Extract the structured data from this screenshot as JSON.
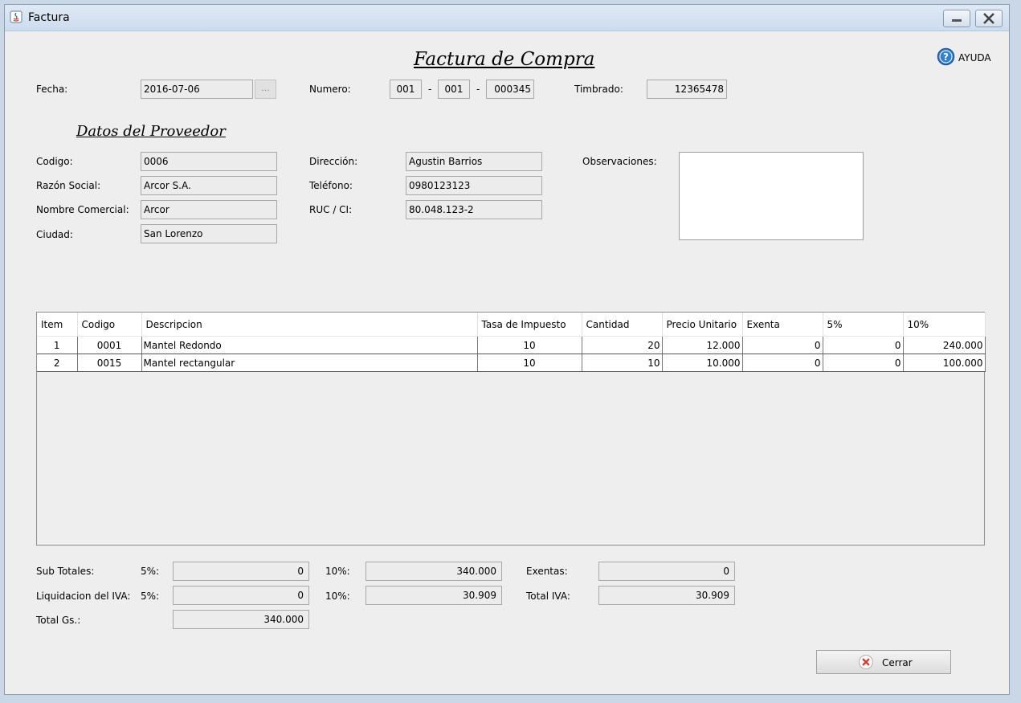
{
  "window": {
    "title": "Factura"
  },
  "header": {
    "title": "Factura de Compra",
    "help_label": "AYUDA"
  },
  "invoice": {
    "fecha_label": "Fecha:",
    "fecha_value": "2016-07-06",
    "date_button_label": "...",
    "numero_label": "Numero:",
    "numero_1": "001",
    "numero_sep_1": "-",
    "numero_2": "001",
    "numero_sep_2": "-",
    "numero_3": "000345",
    "timbrado_label": "Timbrado:",
    "timbrado_value": "12365478"
  },
  "proveedor": {
    "section_title": "Datos del Proveedor",
    "codigo_label": "Codigo:",
    "codigo_value": "0006",
    "razon_label": "Razón Social:",
    "razon_value": "Arcor S.A.",
    "nombre_label": "Nombre Comercial:",
    "nombre_value": "Arcor",
    "ciudad_label": "Ciudad:",
    "ciudad_value": "San Lorenzo",
    "direccion_label": "Dirección:",
    "direccion_value": "Agustin Barrios",
    "telefono_label": "Teléfono:",
    "telefono_value": "0980123123",
    "ruc_label": "RUC / CI:",
    "ruc_value": "80.048.123-2",
    "observaciones_label": "Observaciones:",
    "observaciones_value": ""
  },
  "table": {
    "columns": [
      "Item",
      "Codigo",
      "Descripcion",
      "Tasa de Impuesto",
      "Cantidad",
      "Precio Unitario",
      "Exenta",
      "5%",
      "10%"
    ],
    "rows": [
      [
        "1",
        "0001",
        "Mantel Redondo",
        "10",
        "20",
        "12.000",
        "0",
        "0",
        "240.000"
      ],
      [
        "2",
        "0015",
        "Mantel rectangular",
        "10",
        "10",
        "10.000",
        "0",
        "0",
        "100.000"
      ]
    ]
  },
  "totals": {
    "subtotales_label": "Sub Totales:",
    "sub_5_label": "5%:",
    "sub_5_value": "0",
    "sub_10_label": "10%:",
    "sub_10_value": "340.000",
    "exentas_label": "Exentas:",
    "exentas_value": "0",
    "liq_label": "Liquidacion del IVA:",
    "liq_5_label": "5%:",
    "liq_5_value": "0",
    "liq_10_label": "10%:",
    "liq_10_value": "30.909",
    "total_iva_label": "Total IVA:",
    "total_iva_value": "30.909",
    "total_gs_label": "Total Gs.:",
    "total_gs_value": "340.000"
  },
  "actions": {
    "cerrar_label": "Cerrar"
  },
  "colors": {
    "help_icon": "#2f7fd6",
    "close_icon": "#d9372c"
  }
}
